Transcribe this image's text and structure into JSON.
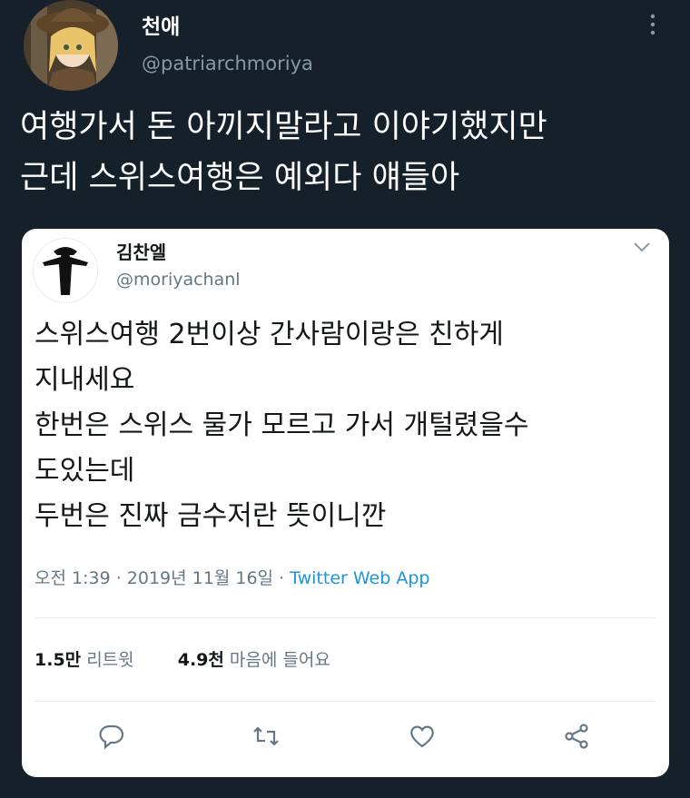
{
  "tweet": {
    "author_name": "천애",
    "author_handle": "@patriarchmoriya",
    "text_lines": [
      "여행가서 돈 아끼지말라고 이야기했지만",
      "근데 스위스여행은 예외다 얘들아"
    ]
  },
  "quoted": {
    "author_name": "김찬엘",
    "author_handle": "@moriyachanl",
    "text_lines": [
      "스위스여행 2번이상 간사람이랑은 친하게",
      "지내세요",
      "한번은 스위스 물가 모르고 가서 개털렸을수",
      "도있는데",
      "두번은 진짜 금수저란 뜻이니깐"
    ],
    "timestamp": "오전 1:39 · 2019년 11월 16일 · ",
    "source": "Twitter Web App",
    "retweet_count": "1.5만",
    "retweet_label": "리트윗",
    "like_count": "4.9천",
    "like_label": "마음에 들어요"
  },
  "icons": {
    "more": "more-vertical-icon",
    "chevron": "chevron-down-icon",
    "reply": "reply-icon",
    "retweet": "retweet-icon",
    "like": "heart-icon",
    "share": "share-icon"
  },
  "colors": {
    "background": "#15202b",
    "card": "#ffffff",
    "accent": "#1b95e0",
    "muted": "#657786"
  }
}
